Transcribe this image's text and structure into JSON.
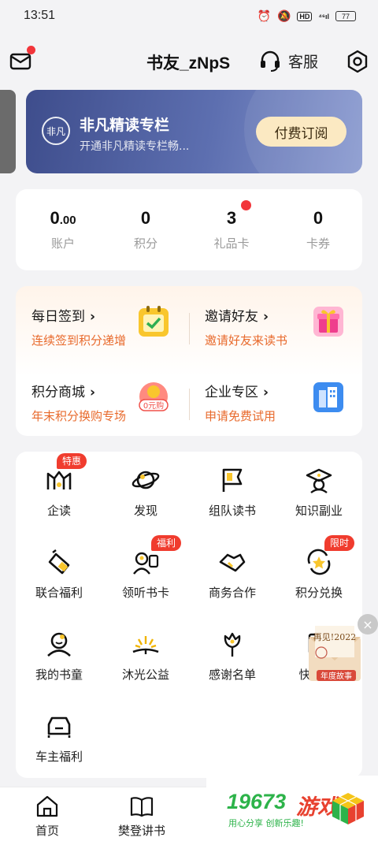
{
  "status_bar": {
    "time": "13:51",
    "network": "⁴⁶ıl",
    "hd": "HD",
    "battery": "77"
  },
  "header": {
    "title": "书友_zNpS",
    "service_label": "客服"
  },
  "banner": {
    "logo_text": "非凡",
    "title": "非凡精读专栏",
    "subtitle": "开通非凡精读专栏畅...",
    "button": "付费订阅"
  },
  "stats": [
    {
      "value": "0",
      "value_small": ".00",
      "label": "账户"
    },
    {
      "value": "0",
      "value_small": "",
      "label": "积分"
    },
    {
      "value": "3",
      "value_small": "",
      "label": "礼品卡"
    },
    {
      "value": "0",
      "value_small": "",
      "label": "卡券"
    }
  ],
  "features": [
    {
      "title": "每日签到",
      "subtitle": "连续签到积分递增",
      "icon": "calendar-check-icon"
    },
    {
      "title": "邀请好友",
      "subtitle": "邀请好友来读书",
      "icon": "gift-icon"
    },
    {
      "title": "积分商城",
      "subtitle": "年末积分换购专场",
      "icon": "coin-icon",
      "icon_text": "0元购"
    },
    {
      "title": "企业专区",
      "subtitle": "申请免费试用",
      "icon": "building-icon"
    }
  ],
  "feature_arrow": "›",
  "grid": [
    {
      "label": "企读",
      "badge": "特惠",
      "icon": "enterprise-read-icon"
    },
    {
      "label": "发现",
      "badge": "",
      "icon": "planet-icon"
    },
    {
      "label": "组队读书",
      "badge": "",
      "icon": "flag-icon"
    },
    {
      "label": "知识副业",
      "badge": "",
      "icon": "graduation-cap-icon"
    },
    {
      "label": "联合福利",
      "badge": "",
      "icon": "hand-coupon-icon"
    },
    {
      "label": "领听书卡",
      "badge": "福利",
      "icon": "listener-icon"
    },
    {
      "label": "商务合作",
      "badge": "",
      "icon": "handshake-icon"
    },
    {
      "label": "积分兑换",
      "badge": "限时",
      "icon": "exchange-star-icon"
    },
    {
      "label": "我的书童",
      "badge": "",
      "icon": "kid-icon"
    },
    {
      "label": "沐光公益",
      "badge": "",
      "icon": "sunrise-book-icon"
    },
    {
      "label": "感谢名单",
      "badge": "",
      "icon": "flower-icon"
    },
    {
      "label": "快",
      "badge": "",
      "icon": "quick-icon"
    },
    {
      "label": "车主福利",
      "badge": "",
      "icon": "car-icon"
    }
  ],
  "float_ad": {
    "title": "再见!2022",
    "caption": "年度故事",
    "close": "×"
  },
  "nav": [
    {
      "label": "首页",
      "icon": "home-icon"
    },
    {
      "label": "樊登讲书",
      "icon": "open-book-icon"
    }
  ],
  "watermark": {
    "number": "19673",
    "text": "游戏",
    "tagline": "用心分享 创新乐趣!"
  },
  "colors": {
    "accent_orange": "#e86a2c",
    "badge_red": "#f03c2e",
    "banner_blue": "#3e4d8c"
  }
}
